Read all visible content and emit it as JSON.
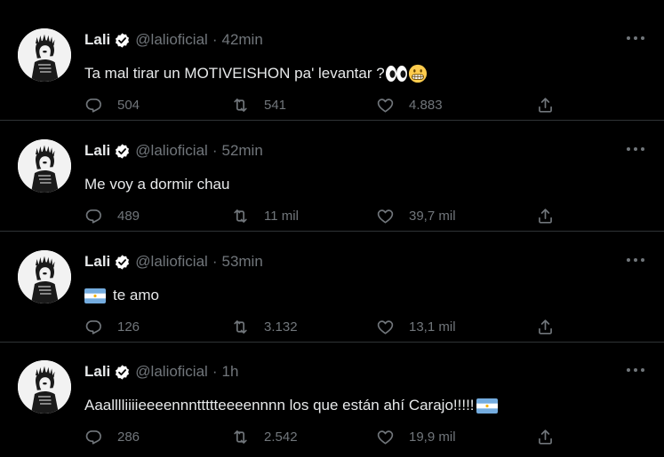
{
  "author": {
    "name": "Lali",
    "handle": "@lalioficial",
    "separator": "·"
  },
  "tweets": [
    {
      "time": "42min",
      "text": "Ta mal tirar un MOTIVEISHON pa' levantar ?",
      "trailing_emojis": [
        "eyes",
        "grimacing-face"
      ],
      "replies": "504",
      "retweets": "541",
      "likes": "4.883"
    },
    {
      "time": "52min",
      "text": "Me voy a dormir chau",
      "replies": "489",
      "retweets": "11 mil",
      "likes": "39,7 mil"
    },
    {
      "time": "53min",
      "text": "te amo",
      "leading_emoji": "argentina-flag",
      "replies": "126",
      "retweets": "3.132",
      "likes": "13,1 mil"
    },
    {
      "time": "1h",
      "text": "Aaalllliiiieeeennnttttteeeennnn los que están ahí Carajo!!!!!",
      "trailing_emojis": [
        "argentina-flag"
      ],
      "replies": "286",
      "retweets": "2.542",
      "likes": "19,9 mil"
    }
  ],
  "colors": {
    "background": "#000000",
    "text": "#e7e9ea",
    "secondary": "#71767b",
    "divider": "#2f3336",
    "verified": "#ffffff"
  },
  "icons": [
    "verified-badge-icon",
    "more-icon",
    "reply-icon",
    "retweet-icon",
    "like-icon",
    "share-icon"
  ]
}
